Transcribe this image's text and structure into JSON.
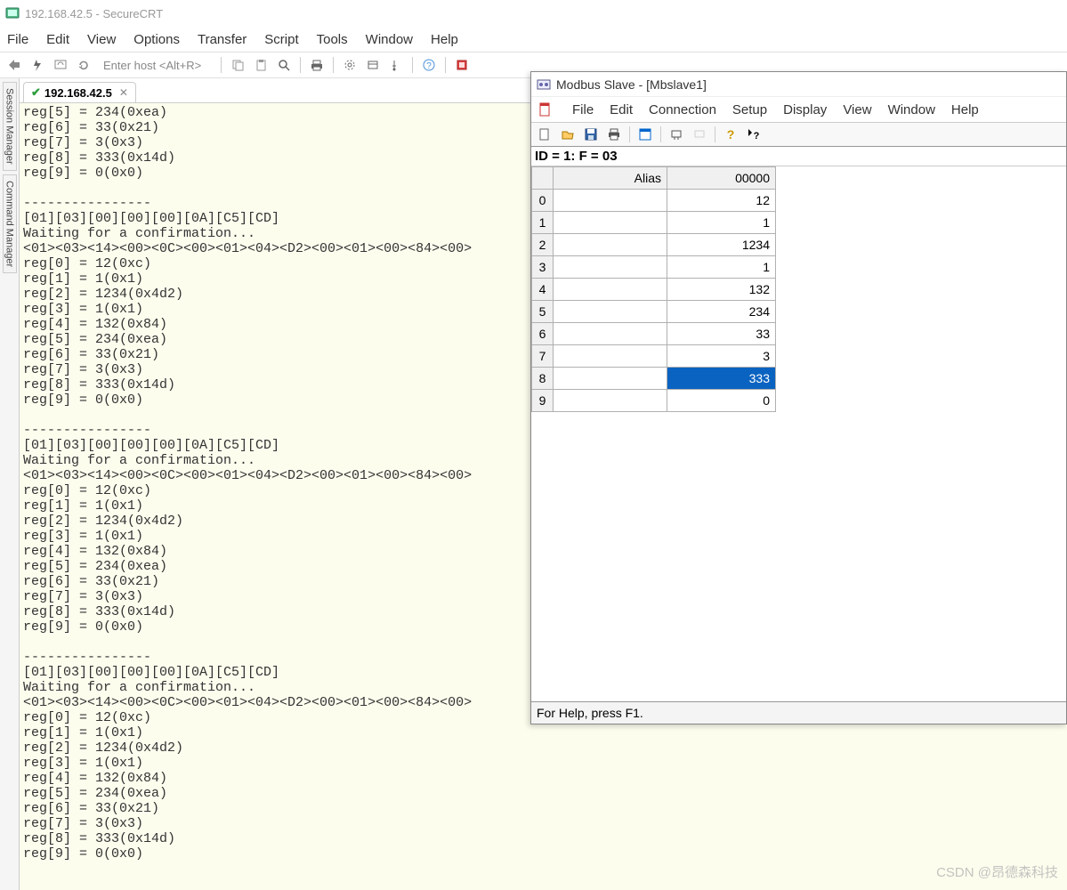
{
  "securecrt": {
    "title": "192.168.42.5 - SecureCRT",
    "menu": {
      "file": "File",
      "edit": "Edit",
      "view": "View",
      "options": "Options",
      "transfer": "Transfer",
      "script": "Script",
      "tools": "Tools",
      "window": "Window",
      "help": "Help"
    },
    "toolbar": {
      "host_placeholder": "Enter host <Alt+R>"
    },
    "side_tabs": {
      "session_manager": "Session Manager",
      "command_manager": "Command Manager"
    },
    "tab": {
      "label": "192.168.42.5"
    },
    "terminal": "reg[5] = 234(0xea)\nreg[6] = 33(0x21)\nreg[7] = 3(0x3)\nreg[8] = 333(0x14d)\nreg[9] = 0(0x0)\n\n----------------\n[01][03][00][00][00][0A][C5][CD]\nWaiting for a confirmation...\n<01><03><14><00><0C><00><01><04><D2><00><01><00><84><00>\nreg[0] = 12(0xc)\nreg[1] = 1(0x1)\nreg[2] = 1234(0x4d2)\nreg[3] = 1(0x1)\nreg[4] = 132(0x84)\nreg[5] = 234(0xea)\nreg[6] = 33(0x21)\nreg[7] = 3(0x3)\nreg[8] = 333(0x14d)\nreg[9] = 0(0x0)\n\n----------------\n[01][03][00][00][00][0A][C5][CD]\nWaiting for a confirmation...\n<01><03><14><00><0C><00><01><04><D2><00><01><00><84><00>\nreg[0] = 12(0xc)\nreg[1] = 1(0x1)\nreg[2] = 1234(0x4d2)\nreg[3] = 1(0x1)\nreg[4] = 132(0x84)\nreg[5] = 234(0xea)\nreg[6] = 33(0x21)\nreg[7] = 3(0x3)\nreg[8] = 333(0x14d)\nreg[9] = 0(0x0)\n\n----------------\n[01][03][00][00][00][0A][C5][CD]\nWaiting for a confirmation...\n<01><03><14><00><0C><00><01><04><D2><00><01><00><84><00>\nreg[0] = 12(0xc)\nreg[1] = 1(0x1)\nreg[2] = 1234(0x4d2)\nreg[3] = 1(0x1)\nreg[4] = 132(0x84)\nreg[5] = 234(0xea)\nreg[6] = 33(0x21)\nreg[7] = 3(0x3)\nreg[8] = 333(0x14d)\nreg[9] = 0(0x0)"
  },
  "modbus": {
    "title": "Modbus Slave - [Mbslave1]",
    "menu": {
      "file": "File",
      "edit": "Edit",
      "connection": "Connection",
      "setup": "Setup",
      "display": "Display",
      "view": "View",
      "window": "Window",
      "help": "Help"
    },
    "status": "ID = 1: F = 03",
    "headers": {
      "alias": "Alias",
      "col0": "00000"
    },
    "rows": [
      {
        "idx": "0",
        "alias": "",
        "val": "12"
      },
      {
        "idx": "1",
        "alias": "",
        "val": "1"
      },
      {
        "idx": "2",
        "alias": "",
        "val": "1234"
      },
      {
        "idx": "3",
        "alias": "",
        "val": "1"
      },
      {
        "idx": "4",
        "alias": "",
        "val": "132"
      },
      {
        "idx": "5",
        "alias": "",
        "val": "234"
      },
      {
        "idx": "6",
        "alias": "",
        "val": "33"
      },
      {
        "idx": "7",
        "alias": "",
        "val": "3"
      },
      {
        "idx": "8",
        "alias": "",
        "val": "333"
      },
      {
        "idx": "9",
        "alias": "",
        "val": "0"
      }
    ],
    "selected_row": 8,
    "footer": "For Help, press F1."
  },
  "watermark": "CSDN @昂德森科技"
}
